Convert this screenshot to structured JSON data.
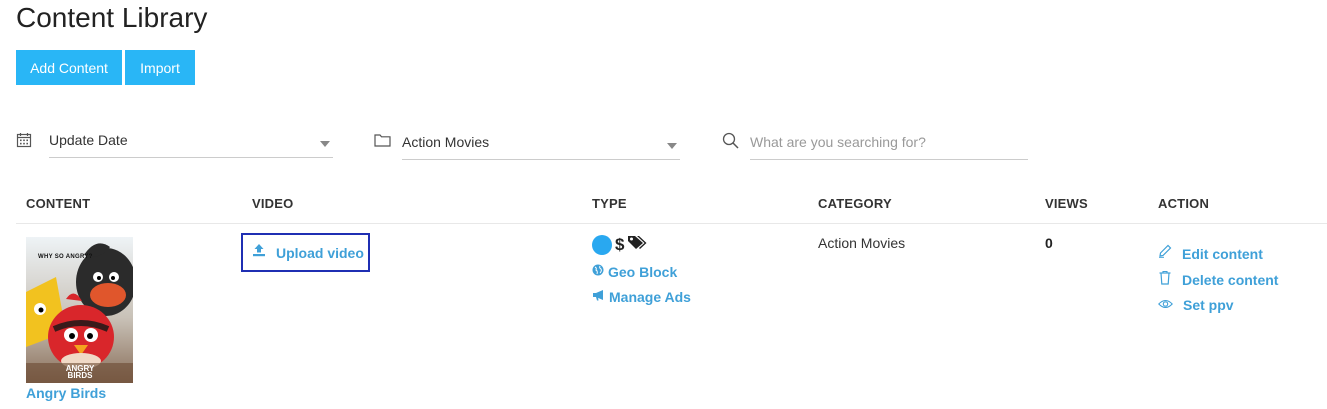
{
  "page": {
    "title": "Content Library"
  },
  "toolbar": {
    "add_label": "Add Content",
    "import_label": "Import"
  },
  "filters": {
    "date": {
      "value": "Update Date"
    },
    "category": {
      "value": "Action Movies"
    },
    "search": {
      "placeholder": "What are you searching for?"
    }
  },
  "table": {
    "headers": [
      "CONTENT",
      "VIDEO",
      "TYPE",
      "CATEGORY",
      "VIEWS",
      "ACTION"
    ],
    "rows": [
      {
        "title": "Angry Birds",
        "poster_caption": "WHY SO ANGRY?",
        "poster_logo": "ANGRY BIRDS",
        "video_action": "Upload video",
        "type_symbol": "$",
        "type_links": [
          "Geo Block",
          "Manage Ads"
        ],
        "category": "Action Movies",
        "views": "0",
        "actions": [
          "Edit content",
          "Delete content",
          "Set ppv"
        ]
      }
    ]
  },
  "colors": {
    "accent": "#29b6f6",
    "link": "#3fa0d8",
    "highlight_border": "#1f2fb3"
  },
  "icons": [
    "calendar-icon",
    "folder-icon",
    "search-icon",
    "upload-icon",
    "circle-icon",
    "tags-icon",
    "globe-icon",
    "bullhorn-icon",
    "pencil-icon",
    "trash-icon",
    "eye-icon"
  ]
}
